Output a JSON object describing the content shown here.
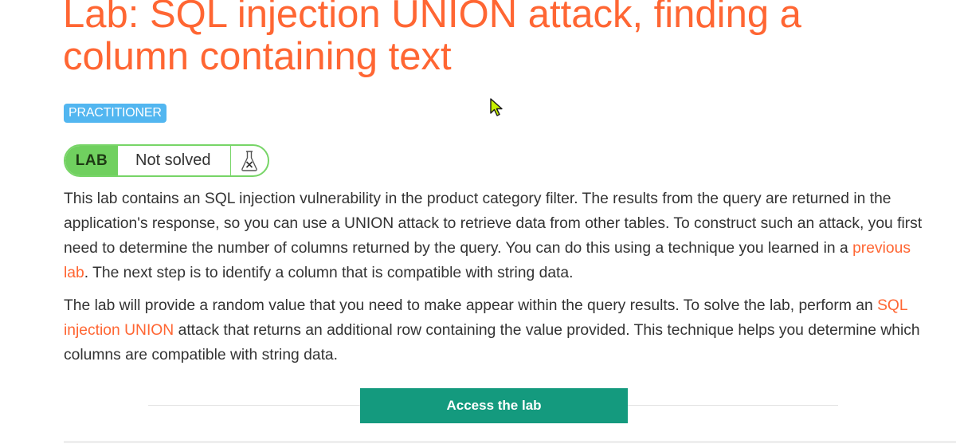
{
  "lab": {
    "title": "Lab: SQL injection UNION attack, finding a column containing text",
    "level": "PRACTITIONER",
    "status_tag": "LAB",
    "status_text": "Not solved",
    "status_icon": "flask-icon",
    "colors": {
      "title": "#ff6633",
      "badge": "#52b6f0",
      "status_green": "#70d05f",
      "button": "#149a7e",
      "link": "#ff6633"
    }
  },
  "description": {
    "p1_before_link": "This lab contains an SQL injection vulnerability in the product category filter. The results from the query are returned in the application's response, so you can use a UNION attack to retrieve data from other tables. To construct such an attack, you first need to determine the number of columns returned by the query. You can do this using a technique you learned in a ",
    "p1_link": "previous lab",
    "p1_after_link": ". The next step is to identify a column that is compatible with string data.",
    "p2_before_link": "The lab will provide a random value that you need to make appear within the query results. To solve the lab, perform an ",
    "p2_link": "SQL injection UNION",
    "p2_after_link": " attack that returns an additional row containing the value provided. This technique helps you determine which columns are compatible with string data."
  },
  "actions": {
    "access_label": "Access the lab"
  }
}
